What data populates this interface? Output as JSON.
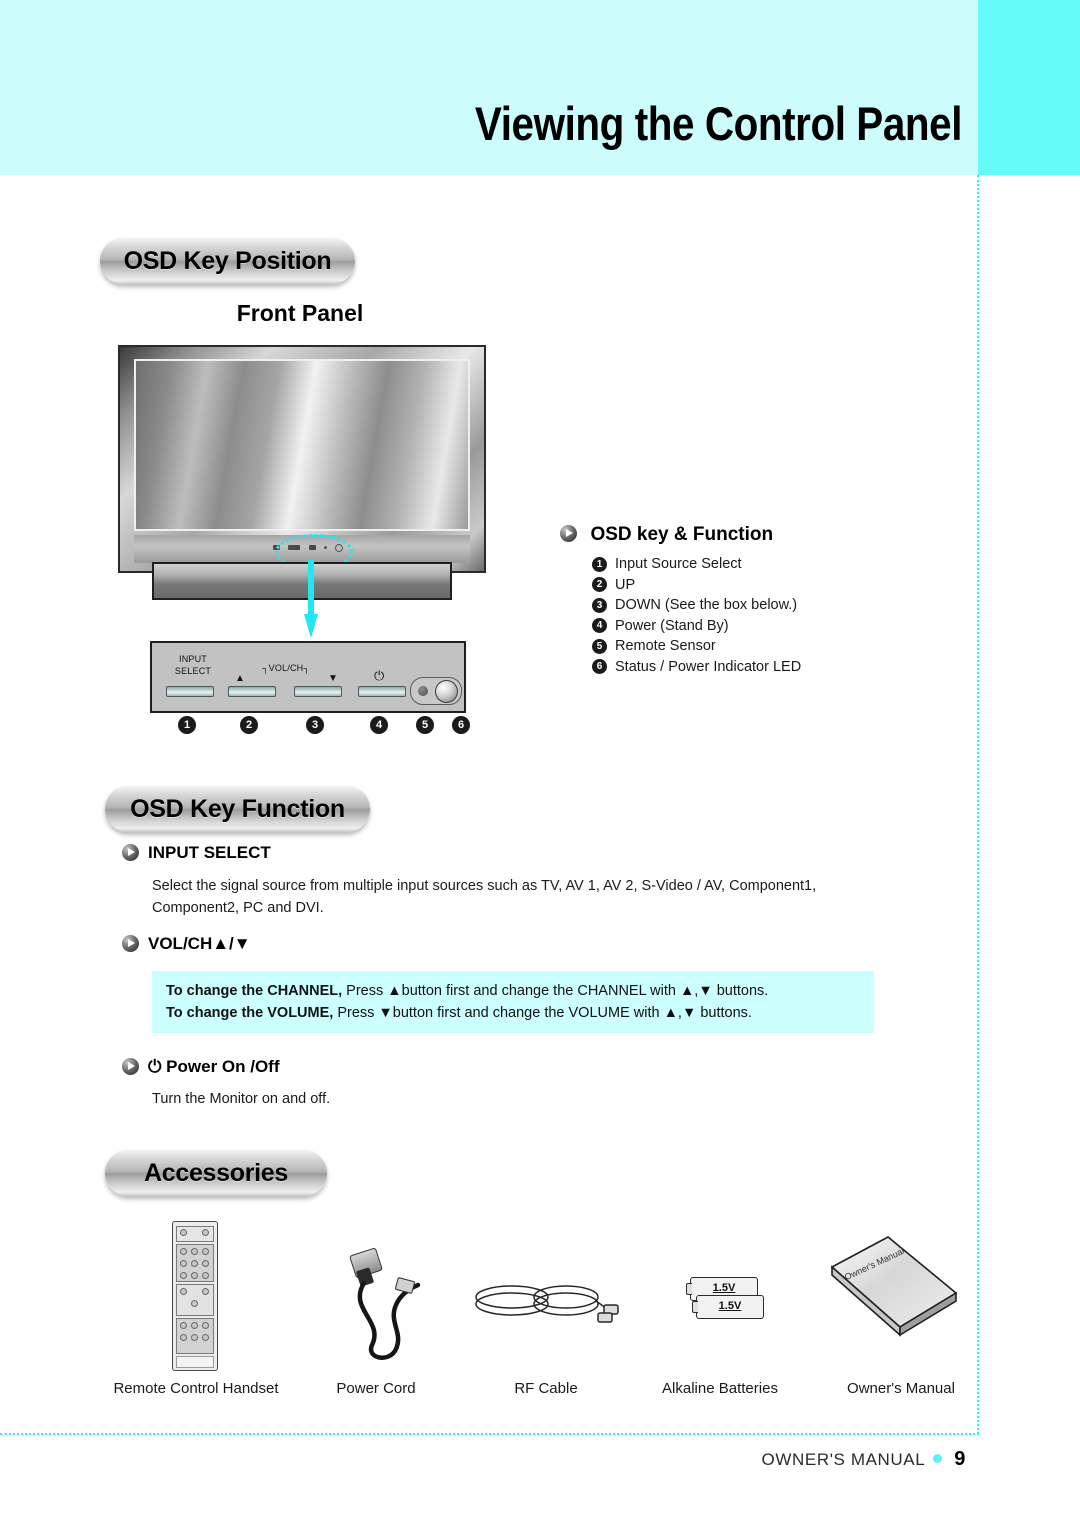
{
  "header": {
    "title": "Viewing the Control Panel",
    "band_color": "#ccfcfc",
    "accent_color": "#66fbfb"
  },
  "sections": {
    "osd_key_position": "OSD Key Position",
    "osd_key_function": "OSD Key Function",
    "accessories": "Accessories"
  },
  "front_panel": {
    "heading": "Front Panel",
    "control_panel": {
      "input_select_label_line1": "INPUT",
      "input_select_label_line2": "SELECT",
      "volch_label": "VOL/CH",
      "arrow_up": "▲",
      "arrow_down": "▼",
      "power_glyph": "⏻",
      "numbers": [
        "1",
        "2",
        "3",
        "4",
        "5",
        "6"
      ]
    }
  },
  "osd_key_and_function": {
    "title": "OSD key & Function",
    "items": [
      {
        "num": "1",
        "label": "Input Source Select"
      },
      {
        "num": "2",
        "label": "UP"
      },
      {
        "num": "3",
        "label": "DOWN (See the box below.)"
      },
      {
        "num": "4",
        "label": "Power (Stand By)"
      },
      {
        "num": "5",
        "label": "Remote Sensor"
      },
      {
        "num": "6",
        "label": "Status / Power Indicator LED"
      }
    ]
  },
  "osd_function_details": {
    "input_select": {
      "heading": "INPUT SELECT",
      "body": "Select the signal source from multiple input sources such as TV, AV 1, AV 2, S-Video / AV, Component1, Component2,  PC and DVI."
    },
    "volch": {
      "heading": "VOL/CH▲/▼",
      "note_box_color": "#ccffff",
      "note_line1_bold": "To change the CHANNEL,",
      "note_line1_rest": " Press ▲button first and change the CHANNEL with ▲,▼ buttons.",
      "note_line2_bold": "To change the VOLUME,",
      "note_line2_rest": " Press ▼button first and change the VOLUME with ▲,▼ buttons."
    },
    "power": {
      "heading": "⏻ Power On /Off",
      "body": "Turn the Monitor on and off."
    }
  },
  "accessories_items": [
    {
      "caption": "Remote Control Handset"
    },
    {
      "caption": "Power Cord"
    },
    {
      "caption": "RF Cable"
    },
    {
      "caption": "Alkaline Batteries",
      "battery_voltage_1": "1.5V",
      "battery_voltage_2": "1.5V"
    },
    {
      "caption": "Owner's Manual",
      "cover_text": "Owner's Manual"
    }
  ],
  "footer": {
    "label": "OWNER'S MANUAL",
    "page": "9",
    "dot_color": "#5ef0f7"
  }
}
